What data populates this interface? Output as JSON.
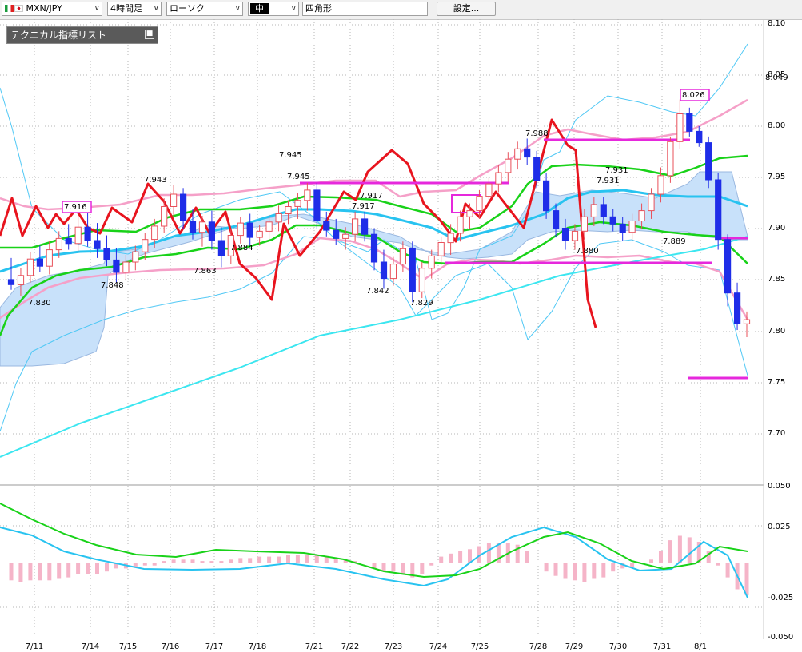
{
  "toolbar": {
    "symbol": "MXN/JPY",
    "timeframe": "4時間足",
    "chart_style": "ローソク",
    "line_width": "中",
    "drawing_tool": "四角形",
    "settings_button": "設定..."
  },
  "panel": {
    "title": "テクニカル指標リスト"
  },
  "colors": {
    "up_candle": "#e8505a",
    "down_candle": "#1f2de8",
    "rsi_line": "#e8141e",
    "ma_green": "#19d219",
    "ma_cyan": "#28c3f0",
    "bollinger_pink": "#f5a0c8",
    "bollinger_outer": "#50c8f5",
    "long_ma": "#3ce6f0",
    "ichimoku_cloud": "#c8e1fa",
    "drawn_lines": "#e628dc",
    "macd_hist": "#f5b4c8"
  },
  "chart_data": {
    "type": "candlestick",
    "symbol": "MXN/JPY",
    "timeframe": "4時間足",
    "price_axis_ticks": [
      "8.10",
      "8.05",
      "8.00",
      "7.95",
      "7.90",
      "7.85",
      "7.80",
      "7.75",
      "7.70"
    ],
    "price_axis_overlap_label": "8.049",
    "ylim": [
      7.65,
      8.1
    ],
    "x_tick_labels": [
      "7/11",
      "7/14",
      "7/15",
      "7/16",
      "7/17",
      "7/18",
      "7/21",
      "7/22",
      "7/23",
      "7/24",
      "7/25",
      "7/28",
      "7/29",
      "7/30",
      "7/31",
      "8/1"
    ],
    "price_labels": [
      "7.916",
      "7.830",
      "7.943",
      "7.848",
      "7.863",
      "7.884",
      "7.945",
      "7.945",
      "7.917",
      "7.917",
      "7.842",
      "7.829",
      "7.988",
      "7.931",
      "7.931",
      "7.880",
      "7.889",
      "8.026"
    ],
    "boxed_labels": [
      "7.916",
      "8.026"
    ],
    "candles_ohlc": [
      [
        7.851,
        7.872,
        7.841,
        7.846
      ],
      [
        7.846,
        7.862,
        7.835,
        7.855
      ],
      [
        7.855,
        7.878,
        7.848,
        7.871
      ],
      [
        7.871,
        7.884,
        7.858,
        7.864
      ],
      [
        7.864,
        7.889,
        7.856,
        7.88
      ],
      [
        7.88,
        7.898,
        7.872,
        7.891
      ],
      [
        7.891,
        7.905,
        7.88,
        7.886
      ],
      [
        7.886,
        7.912,
        7.878,
        7.902
      ],
      [
        7.902,
        7.916,
        7.883,
        7.889
      ],
      [
        7.889,
        7.906,
        7.872,
        7.881
      ],
      [
        7.881,
        7.894,
        7.864,
        7.87
      ],
      [
        7.87,
        7.882,
        7.848,
        7.858
      ],
      [
        7.858,
        7.875,
        7.85,
        7.868
      ],
      [
        7.868,
        7.884,
        7.86,
        7.878
      ],
      [
        7.878,
        7.896,
        7.87,
        7.89
      ],
      [
        7.89,
        7.91,
        7.882,
        7.903
      ],
      [
        7.903,
        7.93,
        7.896,
        7.922
      ],
      [
        7.922,
        7.943,
        7.912,
        7.934
      ],
      [
        7.934,
        7.94,
        7.9,
        7.908
      ],
      [
        7.908,
        7.92,
        7.89,
        7.897
      ],
      [
        7.897,
        7.913,
        7.883,
        7.907
      ],
      [
        7.907,
        7.918,
        7.88,
        7.889
      ],
      [
        7.889,
        7.902,
        7.863,
        7.874
      ],
      [
        7.874,
        7.9,
        7.866,
        7.894
      ],
      [
        7.894,
        7.912,
        7.886,
        7.906
      ],
      [
        7.906,
        7.915,
        7.884,
        7.892
      ],
      [
        7.892,
        7.904,
        7.884,
        7.898
      ],
      [
        7.898,
        7.914,
        7.89,
        7.907
      ],
      [
        7.907,
        7.923,
        7.898,
        7.915
      ],
      [
        7.915,
        7.928,
        7.905,
        7.922
      ],
      [
        7.922,
        7.935,
        7.91,
        7.928
      ],
      [
        7.928,
        7.945,
        7.918,
        7.938
      ],
      [
        7.938,
        7.945,
        7.9,
        7.908
      ],
      [
        7.908,
        7.917,
        7.893,
        7.899
      ],
      [
        7.899,
        7.91,
        7.885,
        7.891
      ],
      [
        7.891,
        7.902,
        7.88,
        7.895
      ],
      [
        7.895,
        7.917,
        7.888,
        7.91
      ],
      [
        7.91,
        7.917,
        7.888,
        7.895
      ],
      [
        7.895,
        7.901,
        7.86,
        7.868
      ],
      [
        7.868,
        7.88,
        7.842,
        7.852
      ],
      [
        7.852,
        7.873,
        7.845,
        7.866
      ],
      [
        7.866,
        7.888,
        7.858,
        7.881
      ],
      [
        7.881,
        7.888,
        7.829,
        7.839
      ],
      [
        7.839,
        7.868,
        7.833,
        7.862
      ],
      [
        7.862,
        7.88,
        7.852,
        7.874
      ],
      [
        7.874,
        7.893,
        7.865,
        7.887
      ],
      [
        7.887,
        7.905,
        7.875,
        7.896
      ],
      [
        7.896,
        7.918,
        7.888,
        7.912
      ],
      [
        7.912,
        7.925,
        7.9,
        7.918
      ],
      [
        7.918,
        7.938,
        7.91,
        7.932
      ],
      [
        7.932,
        7.95,
        7.925,
        7.944
      ],
      [
        7.944,
        7.962,
        7.936,
        7.955
      ],
      [
        7.955,
        7.975,
        7.946,
        7.968
      ],
      [
        7.968,
        7.985,
        7.958,
        7.978
      ],
      [
        7.978,
        7.988,
        7.962,
        7.97
      ],
      [
        7.97,
        7.976,
        7.94,
        7.947
      ],
      [
        7.947,
        7.955,
        7.91,
        7.918
      ],
      [
        7.918,
        7.925,
        7.892,
        7.901
      ],
      [
        7.901,
        7.91,
        7.88,
        7.889
      ],
      [
        7.889,
        7.905,
        7.88,
        7.898
      ],
      [
        7.898,
        7.92,
        7.89,
        7.912
      ],
      [
        7.912,
        7.931,
        7.903,
        7.924
      ],
      [
        7.924,
        7.931,
        7.905,
        7.912
      ],
      [
        7.912,
        7.92,
        7.898,
        7.905
      ],
      [
        7.905,
        7.912,
        7.889,
        7.897
      ],
      [
        7.897,
        7.915,
        7.889,
        7.908
      ],
      [
        7.908,
        7.925,
        7.9,
        7.918
      ],
      [
        7.918,
        7.94,
        7.91,
        7.934
      ],
      [
        7.934,
        7.96,
        7.926,
        7.952
      ],
      [
        7.952,
        7.99,
        7.945,
        7.985
      ],
      [
        7.985,
        8.026,
        7.978,
        8.012
      ],
      [
        8.012,
        8.018,
        7.99,
        7.995
      ],
      [
        7.995,
        8.0,
        7.98,
        7.984
      ],
      [
        7.984,
        7.99,
        7.94,
        7.948
      ],
      [
        7.948,
        7.955,
        7.88,
        7.89
      ],
      [
        7.89,
        7.895,
        7.825,
        7.838
      ],
      [
        7.838,
        7.848,
        7.802,
        7.808
      ],
      [
        7.808,
        7.82,
        7.795,
        7.812
      ]
    ],
    "macd_axis_ticks": [
      "0.050",
      "0.025",
      "-0.025",
      "-0.050"
    ],
    "macd_ylim": [
      -0.05,
      0.05
    ]
  }
}
